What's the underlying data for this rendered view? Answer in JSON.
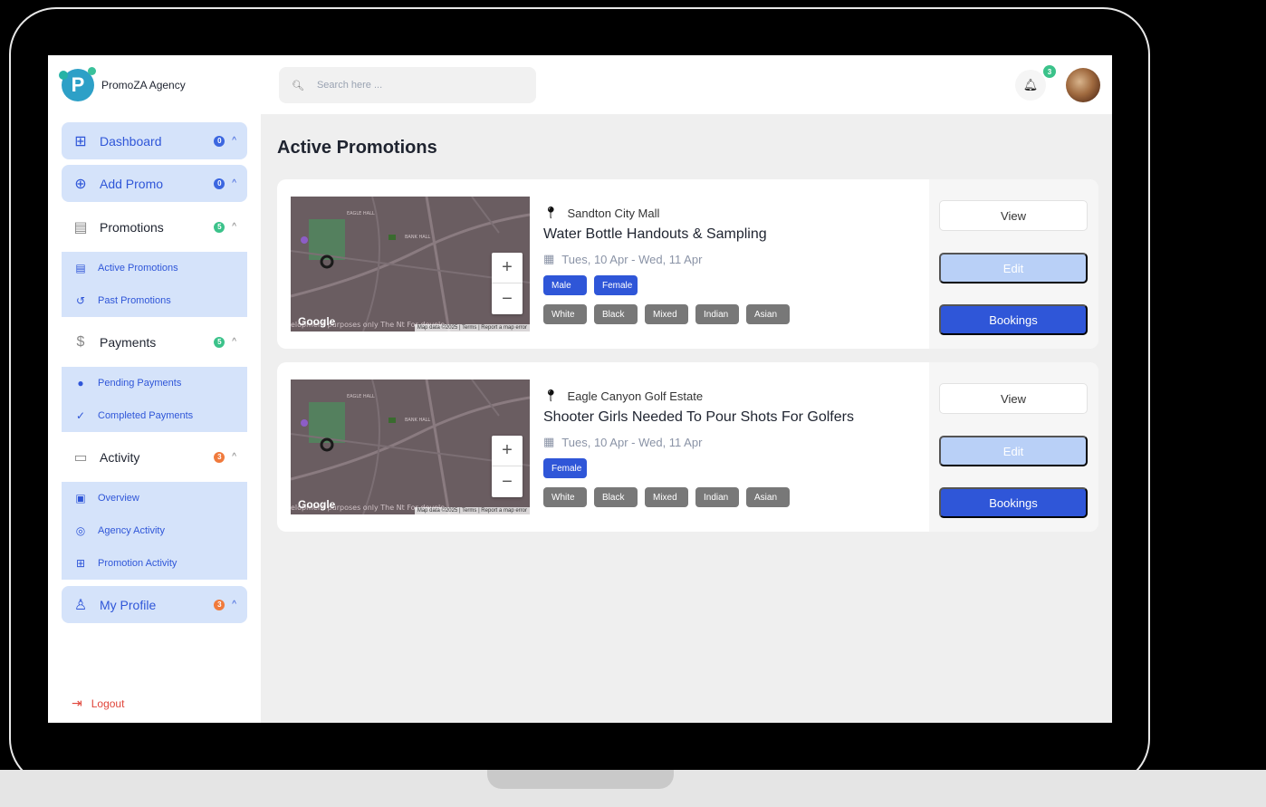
{
  "brand": {
    "name": "PromoZA Agency",
    "logo_letter": "P"
  },
  "sidebar": {
    "items": [
      {
        "label": "Dashboard",
        "badge": "0",
        "icon": "grid-icon"
      },
      {
        "label": "Add Promo",
        "badge": "0",
        "icon": "plus-circle-icon"
      },
      {
        "label": "Promotions",
        "badge": "5",
        "icon": "document-icon"
      },
      {
        "label": "Payments",
        "badge": "5",
        "icon": "dollar-icon"
      },
      {
        "label": "Activity",
        "badge": "3",
        "icon": "chat-icon"
      },
      {
        "label": "My Profile",
        "badge": "3",
        "icon": "user-icon"
      }
    ],
    "promotions_sub": [
      {
        "label": "Active Promotions",
        "icon": "document-icon"
      },
      {
        "label": "Past Promotions",
        "icon": "history-icon"
      }
    ],
    "payments_sub": [
      {
        "label": "Pending Payments",
        "icon": "clock-icon"
      },
      {
        "label": "Completed Payments",
        "icon": "check-icon"
      }
    ],
    "activity_sub": [
      {
        "label": "Overview",
        "icon": "overview-icon"
      },
      {
        "label": "Agency Activity",
        "icon": "target-icon"
      },
      {
        "label": "Promotion Activity",
        "icon": "hierarchy-icon"
      }
    ],
    "logout": "Logout"
  },
  "topbar": {
    "search_placeholder": "Search here ...",
    "notification_count": "3"
  },
  "page_title": "Active Promotions",
  "map": {
    "google": "Google",
    "attribution": "Map data ©2025 | Terms | Report a map error",
    "dev_text": "elopment purposes only The Nt For develo",
    "labels": [
      "EAGLE HALL",
      "BANK HALL"
    ]
  },
  "promotions": [
    {
      "location": "Sandton City Mall",
      "title": "Water Bottle Handouts & Sampling",
      "dates": "Tues, 10 Apr - Wed, 11 Apr",
      "genders": [
        "Male",
        "Female"
      ],
      "races": [
        "White",
        "Black",
        "Mixed",
        "Indian",
        "Asian"
      ]
    },
    {
      "location": "Eagle Canyon Golf Estate",
      "title": "Shooter Girls Needed To Pour Shots For Golfers",
      "dates": "Tues, 10 Apr - Wed, 11 Apr",
      "genders": [
        "Female"
      ],
      "races": [
        "White",
        "Black",
        "Mixed",
        "Indian",
        "Asian"
      ]
    }
  ],
  "actions": {
    "view": "View",
    "edit": "Edit",
    "bookings": "Bookings"
  },
  "colors": {
    "accent": "#2f56d8",
    "active_bg": "#d5e3fa",
    "green_badge": "#3bc28a",
    "orange_badge": "#f07a3c"
  }
}
